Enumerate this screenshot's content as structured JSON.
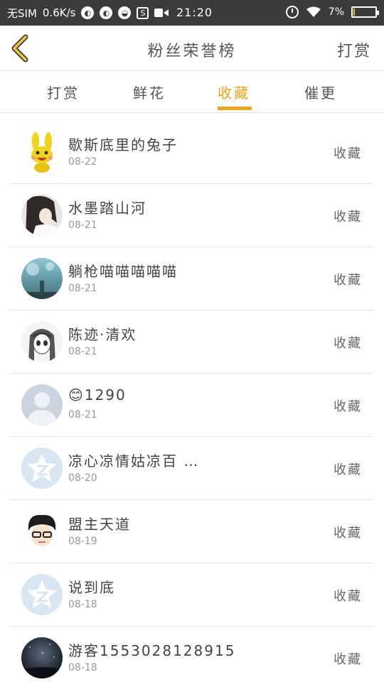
{
  "status_bar": {
    "carrier": "无SIM",
    "speed": "0.6K/s",
    "time": "21:20",
    "battery_percent": "7%",
    "battery_level": 0.07
  },
  "header": {
    "title": "粉丝荣誉榜",
    "action_label": "打赏"
  },
  "tabs": [
    {
      "label": "打赏"
    },
    {
      "label": "鲜花"
    },
    {
      "label": "收藏"
    },
    {
      "label": "催更"
    }
  ],
  "active_tab": 2,
  "accent_color": "#f0a418",
  "list": [
    {
      "name": "歇斯底里的兔子",
      "date": "08-22",
      "action": "收藏",
      "avatar": "yellow-bunny-avatar"
    },
    {
      "name": "水墨踏山河",
      "date": "08-21",
      "action": "收藏",
      "avatar": "ink-portrait-avatar"
    },
    {
      "name": "躺枪喵喵喵喵喵",
      "date": "08-21",
      "action": "收藏",
      "avatar": "blue-sky-avatar"
    },
    {
      "name": "陈迹·清欢",
      "date": "08-21",
      "action": "收藏",
      "avatar": "anime-girl-avatar"
    },
    {
      "name": "😊1290",
      "date": "08-21",
      "action": "收藏",
      "avatar": "default-person-avatar"
    },
    {
      "name": "凉心凉情姑凉百 …",
      "date": "08-20",
      "action": "收藏",
      "avatar": "qzone-star-avatar"
    },
    {
      "name": "盟主天道",
      "date": "08-19",
      "action": "收藏",
      "avatar": "glasses-boy-avatar"
    },
    {
      "name": "说到底",
      "date": "08-18",
      "action": "收藏",
      "avatar": "qzone-star-avatar"
    },
    {
      "name": "游客1553028128915",
      "date": "08-18",
      "action": "收藏",
      "avatar": "night-sky-avatar"
    }
  ]
}
